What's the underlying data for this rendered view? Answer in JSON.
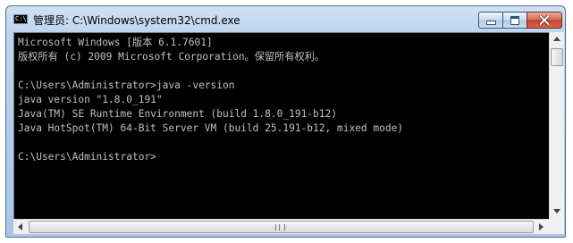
{
  "window": {
    "icon_text": "C:\\",
    "title": "管理员: C:\\Windows\\system32\\cmd.exe"
  },
  "console": {
    "lines": [
      "Microsoft Windows [版本 6.1.7601]",
      "版权所有 (c) 2009 Microsoft Corporation。保留所有权利。",
      "",
      "C:\\Users\\Administrator>java -version",
      "java version \"1.8.0_191\"",
      "Java(TM) SE Runtime Environment (build 1.8.0_191-b12)",
      "Java HotSpot(TM) 64-Bit Server VM (build 25.191-b12, mixed mode)",
      "",
      "C:\\Users\\Administrator>"
    ]
  },
  "colors": {
    "console_bg": "#000000",
    "console_text": "#c0c0c0",
    "close_button": "#c5442a"
  }
}
